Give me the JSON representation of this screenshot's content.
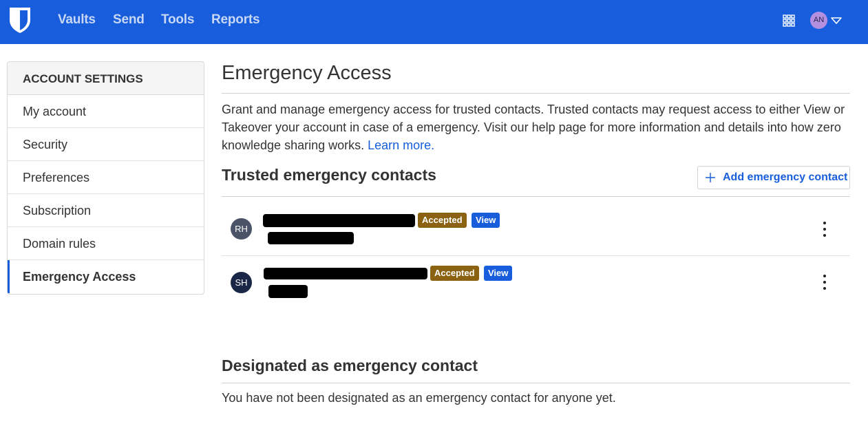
{
  "topnav": {
    "logo": "bitwarden-shield-icon",
    "links": [
      "Vaults",
      "Send",
      "Tools",
      "Reports"
    ],
    "apps_icon": "apps-grid-icon",
    "user_initials": "AN",
    "menu_icon": "caret-down-icon",
    "brand_color": "#175ddc"
  },
  "sidebar": {
    "header": "ACCOUNT SETTINGS",
    "items": [
      {
        "label": "My account",
        "active": false
      },
      {
        "label": "Security",
        "active": false
      },
      {
        "label": "Preferences",
        "active": false
      },
      {
        "label": "Subscription",
        "active": false
      },
      {
        "label": "Domain rules",
        "active": false
      },
      {
        "label": "Emergency Access",
        "active": true
      }
    ]
  },
  "main": {
    "title": "Emergency Access",
    "description": "Grant and manage emergency access for trusted contacts. Trusted contacts may request access to either View or Takeover your account in case of a emergency. Visit our help page for more information and details into how zero knowledge sharing works.",
    "learn_more": "Learn more.",
    "trusted_section": {
      "title": "Trusted emergency contacts",
      "add_button": "Add emergency contact",
      "contacts": [
        {
          "initials": "RH",
          "avatar_color": "#4a5368",
          "status": "Accepted",
          "access_type": "View",
          "name": "[redacted]",
          "email": "[redacted]"
        },
        {
          "initials": "SH",
          "avatar_color": "#1a2646",
          "status": "Accepted",
          "access_type": "View",
          "name": "[redacted]",
          "email": "[redacted]"
        }
      ]
    },
    "designated_section": {
      "title": "Designated as emergency contact",
      "empty_message": "You have not been designated as an emergency contact for anyone yet."
    }
  }
}
